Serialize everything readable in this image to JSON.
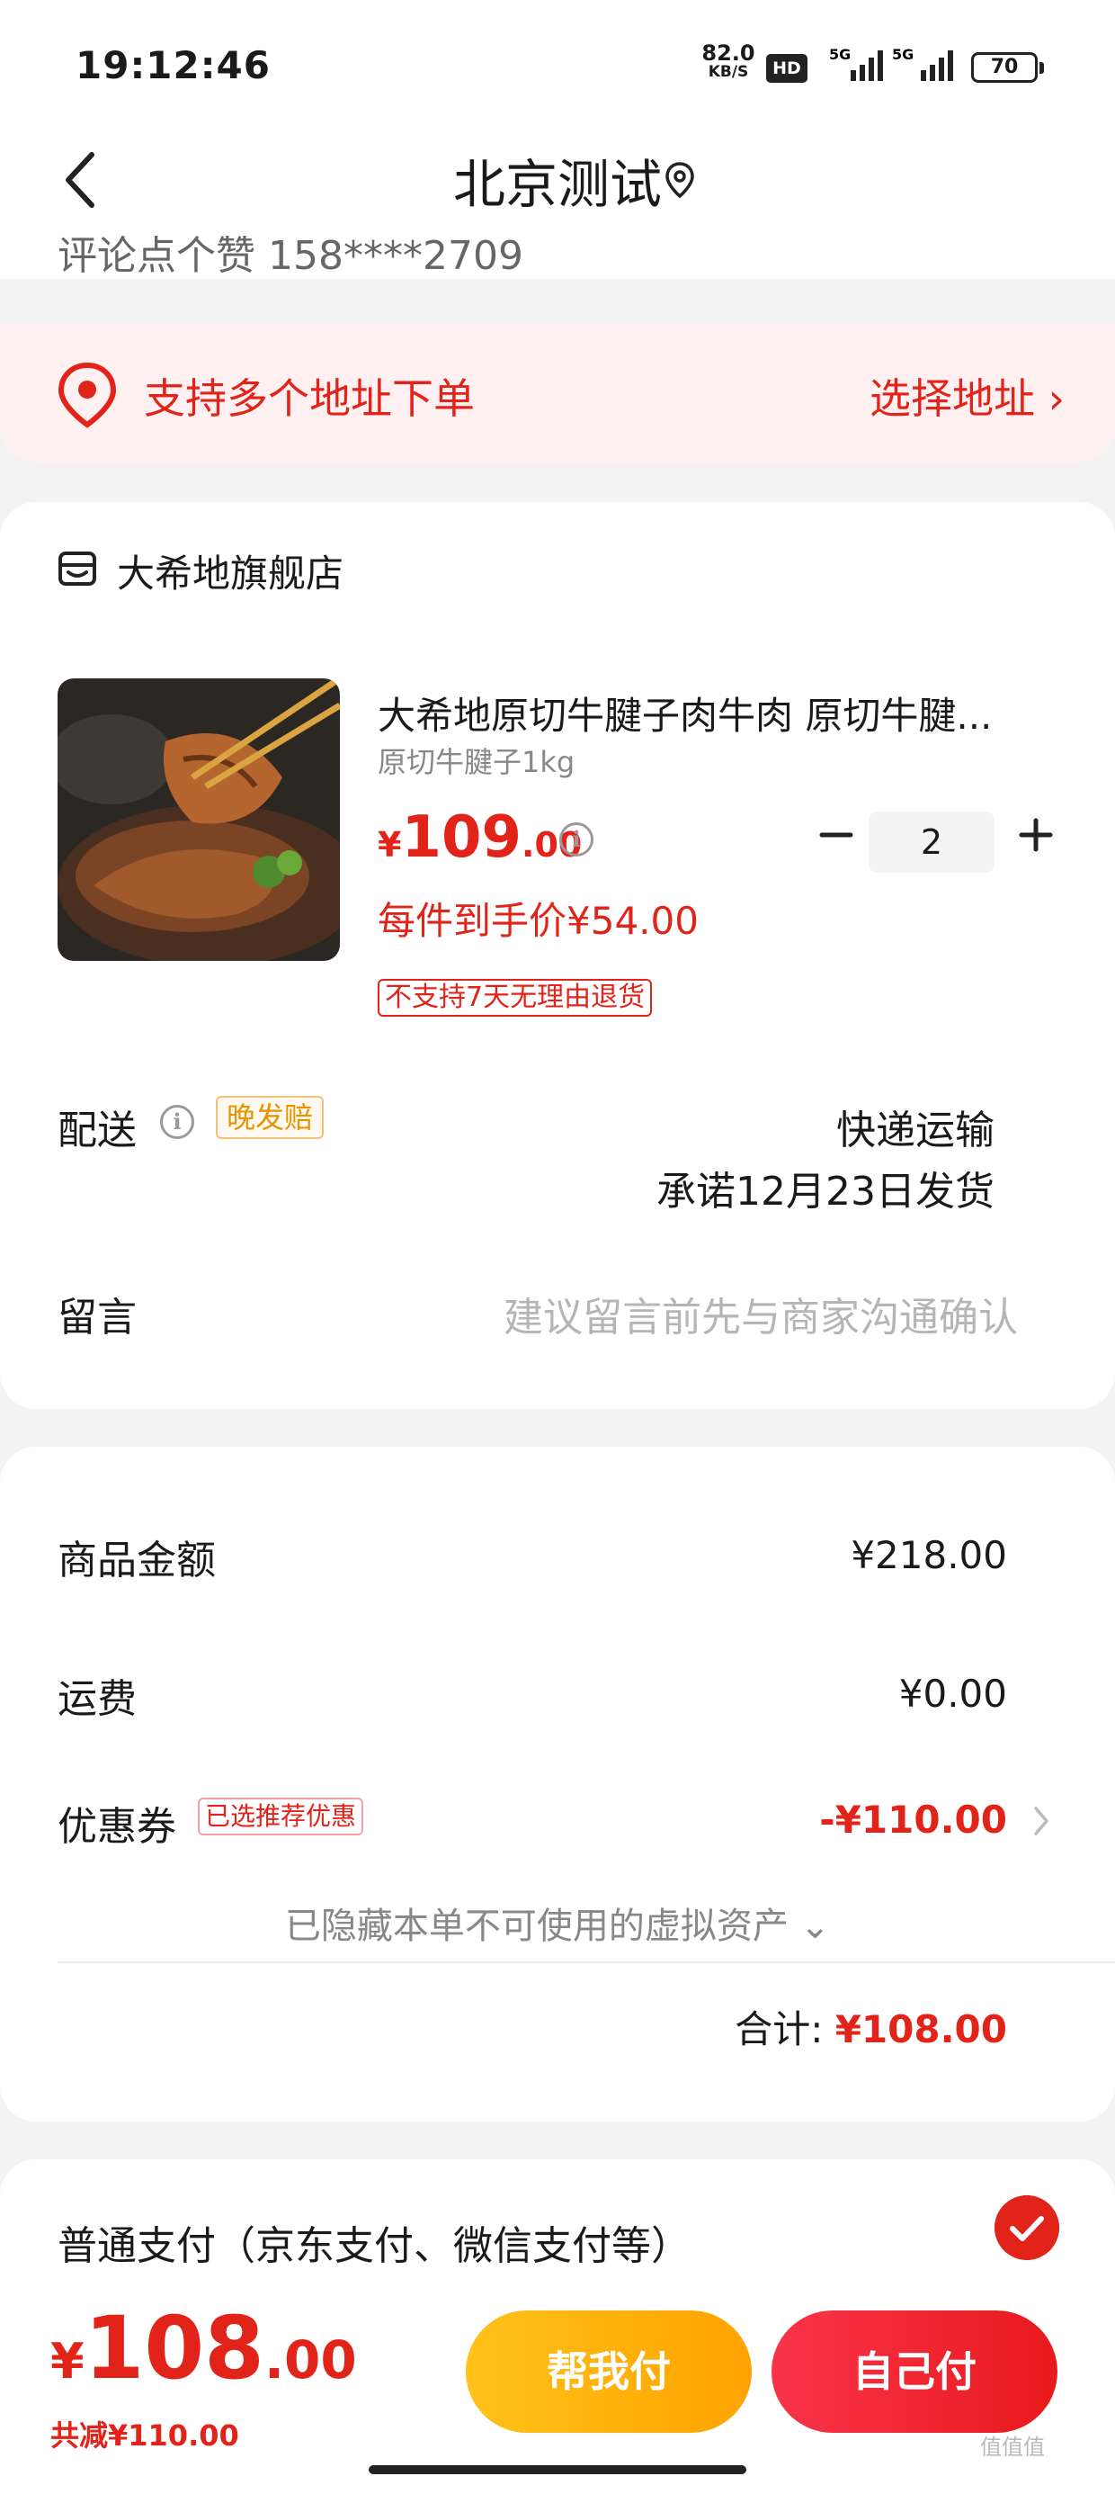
{
  "status_bar": {
    "time": "19:12:46",
    "net_speed": "82.0",
    "net_unit": "KB/S",
    "hd": "HD",
    "signal1": "5G",
    "signal2": "5G",
    "battery": "70"
  },
  "nav": {
    "title": "北京测试",
    "cut_text": "评论点个赞 158****2709"
  },
  "address_banner": {
    "text": "支持多个地址下单",
    "action": "选择地址 ›"
  },
  "store": {
    "name": "大希地旗舰店"
  },
  "product": {
    "title": "大希地原切牛腱子肉牛肉 原切牛腱...",
    "spec": "原切牛腱子1kg",
    "price_symbol": "¥",
    "price_int": "109",
    "price_dec": ".00",
    "unit_price": "每件到手价¥54.00",
    "return_tag": "不支持7天无理由退货",
    "quantity": "2"
  },
  "delivery": {
    "label": "配送",
    "badge": "晚发赔",
    "type": "快递运输",
    "date": "承诺12月23日发货"
  },
  "message": {
    "label": "留言",
    "placeholder": "建议留言前先与商家沟通确认"
  },
  "summary": {
    "goods_label": "商品金额",
    "goods_value": "¥218.00",
    "shipping_label": "运费",
    "shipping_value": "¥0.00",
    "coupon_label": "优惠券",
    "coupon_badge": "已选推荐优惠",
    "coupon_value": "-¥110.00",
    "hidden_tip": "已隐藏本单不可使用的虚拟资产 ⌄",
    "total_label": "合计:",
    "total_value": "¥108.00"
  },
  "payment": {
    "method": "普通支付（京东支付、微信支付等）"
  },
  "bottom": {
    "price_symbol": "¥",
    "price_int": "108",
    "price_dec": ".00",
    "saved": "共减¥110.00",
    "help_pay": "帮我付",
    "self_pay": "自己付"
  },
  "watermark": "值值值"
}
